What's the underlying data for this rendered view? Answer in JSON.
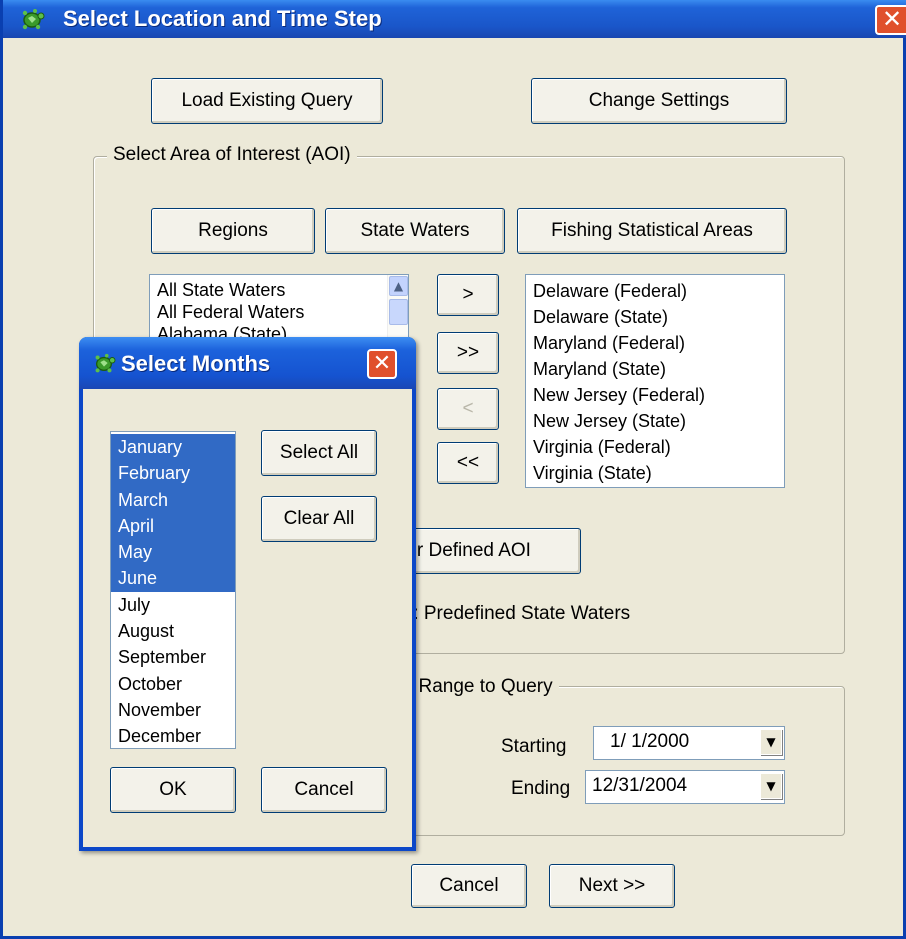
{
  "main": {
    "title": "Select Location and Time Step",
    "close_glyph": "✕",
    "load_query_label": "Load Existing Query",
    "change_settings_label": "Change Settings",
    "aoi_group": {
      "legend": "Select Area of Interest (AOI)",
      "regions_label": "Regions",
      "state_waters_label": "State Waters",
      "fishing_areas_label": "Fishing Statistical Areas",
      "available_items": [
        "All State Waters",
        "All Federal Waters",
        "Alabama (State)"
      ],
      "selected_items": [
        "Delaware (Federal)",
        "Delaware (State)",
        "Maryland (Federal)",
        "Maryland (State)",
        "New Jersey (Federal)",
        "New Jersey (State)",
        "Virginia (Federal)",
        "Virginia (State)"
      ],
      "move_one_label": ">",
      "move_all_label": ">>",
      "remove_one_label": "<",
      "remove_all_label": "<<",
      "user_defined_label": "User Defined AOI",
      "status_text": "Current AOI: Predefined State Waters"
    },
    "date_group": {
      "legend": "Select Date Range to Query",
      "starting_label": "Starting",
      "starting_value": "1/ 1/2000",
      "ending_label": "Ending",
      "ending_value": "12/31/2004"
    },
    "cancel_label": "Cancel",
    "next_label": "Next >>"
  },
  "months_dialog": {
    "title": "Select Months",
    "close_glyph": "✕",
    "months": [
      {
        "label": "January",
        "selected": true
      },
      {
        "label": "February",
        "selected": true
      },
      {
        "label": "March",
        "selected": true
      },
      {
        "label": "April",
        "selected": true
      },
      {
        "label": "May",
        "selected": true
      },
      {
        "label": "June",
        "selected": true
      },
      {
        "label": "July",
        "selected": false
      },
      {
        "label": "August",
        "selected": false
      },
      {
        "label": "September",
        "selected": false
      },
      {
        "label": "October",
        "selected": false
      },
      {
        "label": "November",
        "selected": false
      },
      {
        "label": "December",
        "selected": false
      }
    ],
    "select_all_label": "Select All",
    "clear_all_label": "Clear All",
    "ok_label": "OK",
    "cancel_label": "Cancel"
  },
  "colors": {
    "selection": "#316ac5",
    "titlebar": "#1f63d8",
    "window_bg": "#ece9d8"
  },
  "icons": {
    "app": "turtle-icon",
    "close": "close-icon",
    "dropdown": "chevron-down-icon"
  }
}
